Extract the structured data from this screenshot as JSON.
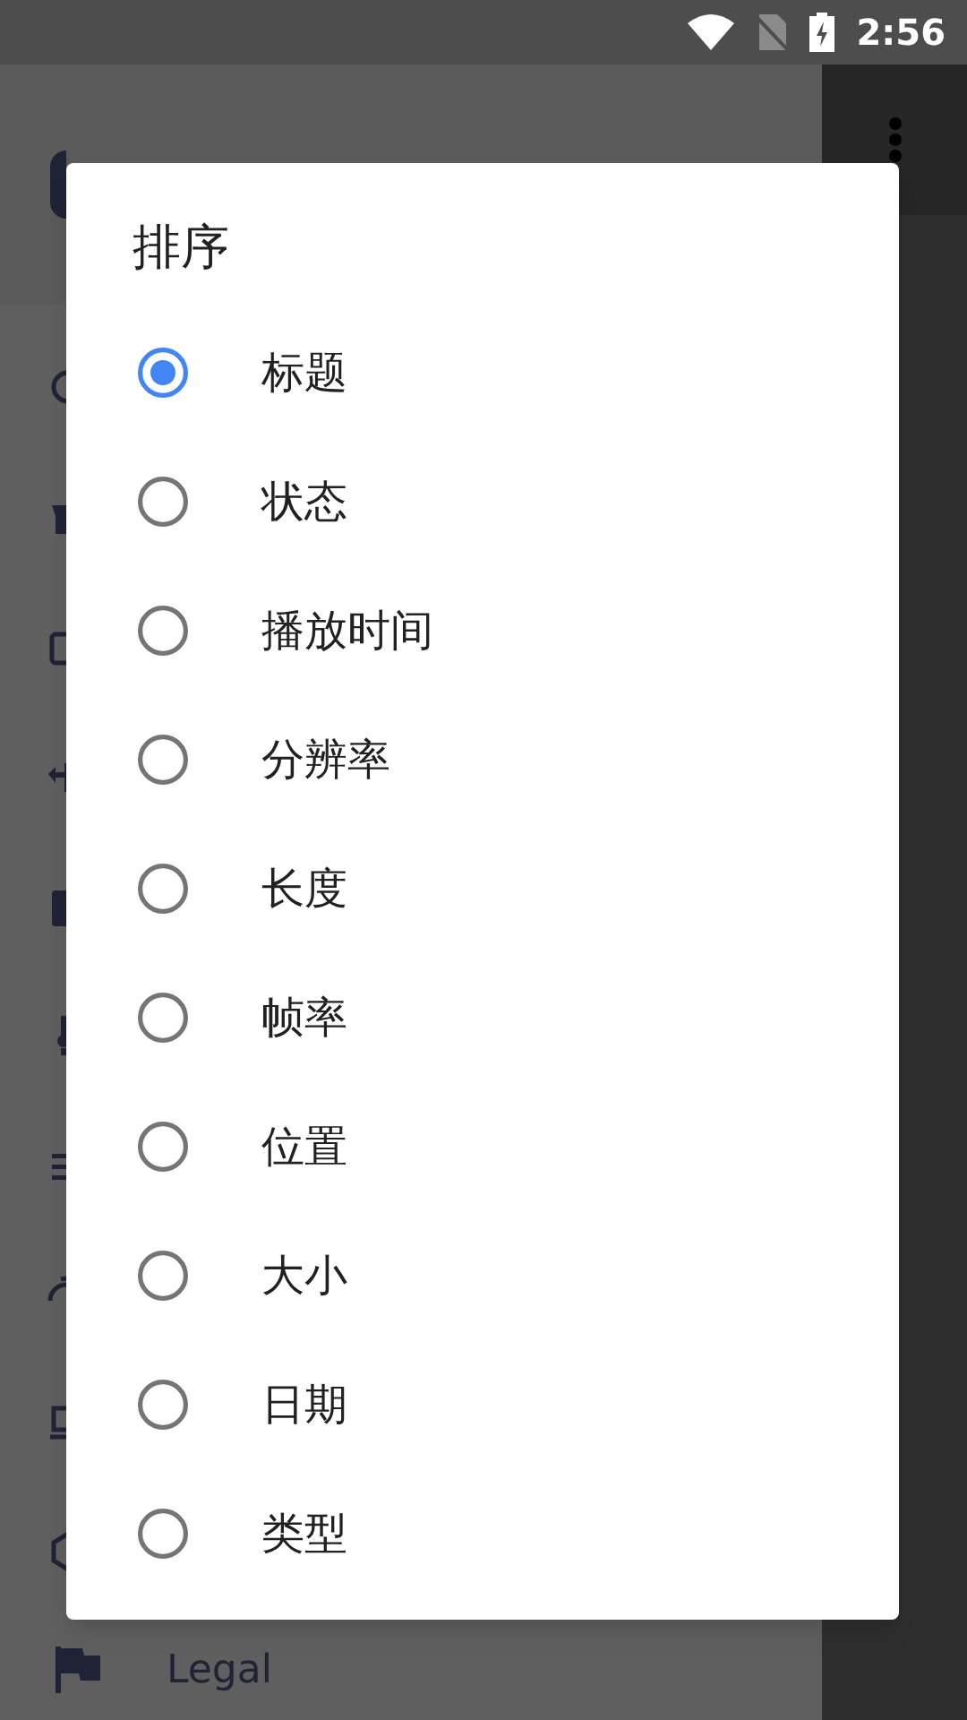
{
  "status_bar": {
    "time": "2:56"
  },
  "drawer": {
    "footer_item": {
      "label": "Legal"
    }
  },
  "dialog": {
    "title": "排序",
    "options": [
      {
        "label": "标题",
        "selected": true
      },
      {
        "label": "状态",
        "selected": false
      },
      {
        "label": "播放时间",
        "selected": false
      },
      {
        "label": "分辨率",
        "selected": false
      },
      {
        "label": "长度",
        "selected": false
      },
      {
        "label": "帧率",
        "selected": false
      },
      {
        "label": "位置",
        "selected": false
      },
      {
        "label": "大小",
        "selected": false
      },
      {
        "label": "日期",
        "selected": false
      },
      {
        "label": "类型",
        "selected": false
      }
    ]
  }
}
